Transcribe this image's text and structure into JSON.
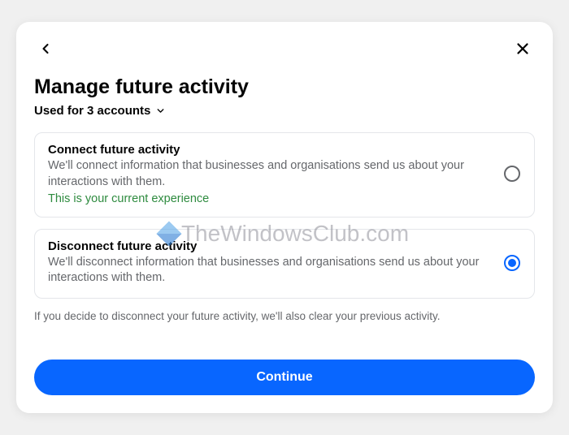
{
  "title": "Manage future activity",
  "accounts": {
    "label": "Used for 3 accounts"
  },
  "options": [
    {
      "title": "Connect future activity",
      "desc": "We'll connect information that businesses and organisations send us about your interactions with them.",
      "note": "This is your current experience",
      "selected": false
    },
    {
      "title": "Disconnect future activity",
      "desc": "We'll disconnect information that businesses and organisations send us about your interactions with them.",
      "note": "",
      "selected": true
    }
  ],
  "footnote": "If you decide to disconnect your future activity, we'll also clear your previous activity.",
  "continue_label": "Continue",
  "watermark": "TheWindowsClub.com"
}
